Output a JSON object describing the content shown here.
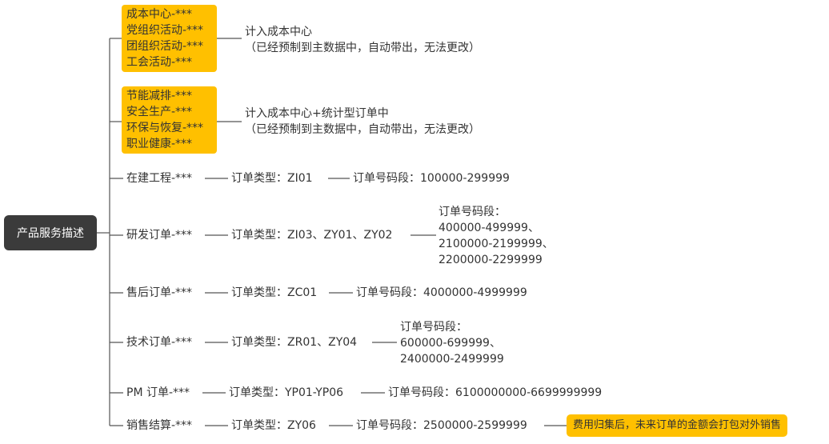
{
  "root": "产品服务描述",
  "groups": [
    {
      "items": [
        "成本中心-***",
        "党组织活动-***",
        "团组织活动-***",
        "工会活动-***"
      ],
      "desc": [
        "计入成本中心",
        "（已经预制到主数据中，自动带出，无法更改）"
      ]
    },
    {
      "items": [
        "节能减排-***",
        "安全生产-***",
        "环保与恢复-***",
        "职业健康-***"
      ],
      "desc": [
        "计入成本中心+统计型订单中",
        "（已经预制到主数据中，自动带出，无法更改）"
      ]
    }
  ],
  "orders": [
    {
      "name": "在建工程-***",
      "type": "订单类型：ZI01",
      "range": [
        "订单号码段：100000-299999"
      ]
    },
    {
      "name": "研发订单-***",
      "type": "订单类型：ZI03、ZY01、ZY02",
      "range": [
        "订单号码段：",
        "400000-499999、",
        "2100000-2199999、",
        "2200000-2299999"
      ]
    },
    {
      "name": "售后订单-***",
      "type": "订单类型：ZC01",
      "range": [
        "订单号码段：4000000-4999999"
      ]
    },
    {
      "name": "技术订单-***",
      "type": "订单类型：ZR01、ZY04",
      "range": [
        "订单号码段：",
        "600000-699999、",
        "2400000-2499999"
      ]
    },
    {
      "name": "PM 订单-***",
      "type": "订单类型：YP01-YP06",
      "range": [
        "订单号码段：6100000000-6699999999"
      ]
    },
    {
      "name": "销售结算-***",
      "type": "订单类型：ZY06",
      "range": [
        "订单号码段：2500000-2599999"
      ],
      "note": "费用归集后，未来订单的金额会打包对外销售"
    }
  ],
  "colors": {
    "root_bg": "#3b3b3b",
    "highlight": "#ffc000",
    "line": "#555555"
  }
}
